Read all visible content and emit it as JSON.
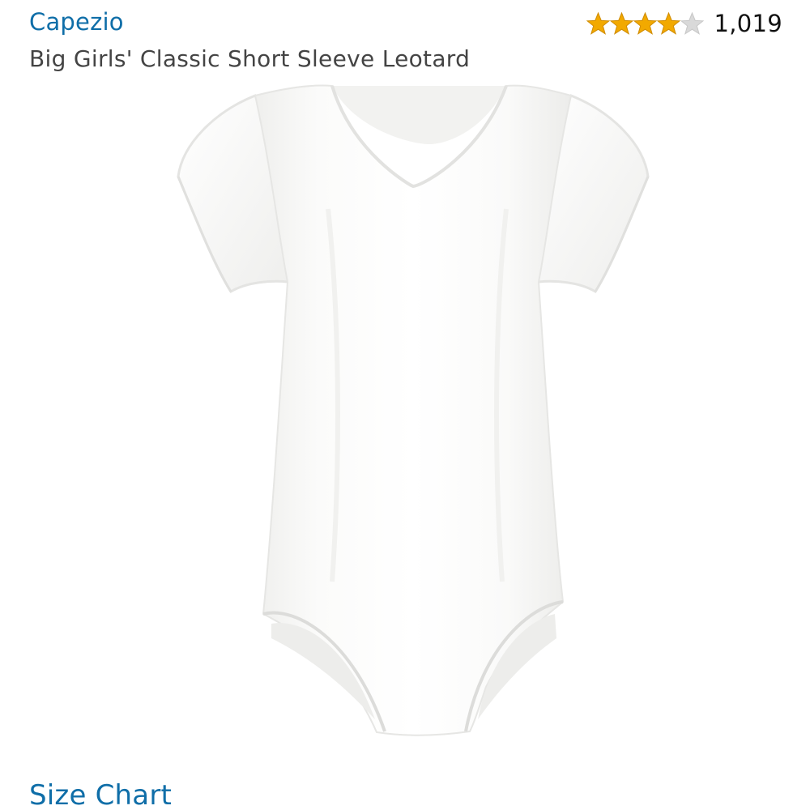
{
  "product": {
    "brand": "Capezio",
    "title": "Big Girls' Classic Short Sleeve Leotard",
    "rating": {
      "stars_filled": 4,
      "stars_total": 5,
      "review_count": "1,019",
      "star_color": "#f2a900",
      "empty_star_color": "#d9d9d9"
    },
    "image": {
      "icon": "white-short-sleeve-leotard"
    }
  },
  "links": {
    "size_chart": "Size Chart"
  },
  "colors": {
    "link": "#0f6ea8",
    "title_text": "#444444"
  }
}
